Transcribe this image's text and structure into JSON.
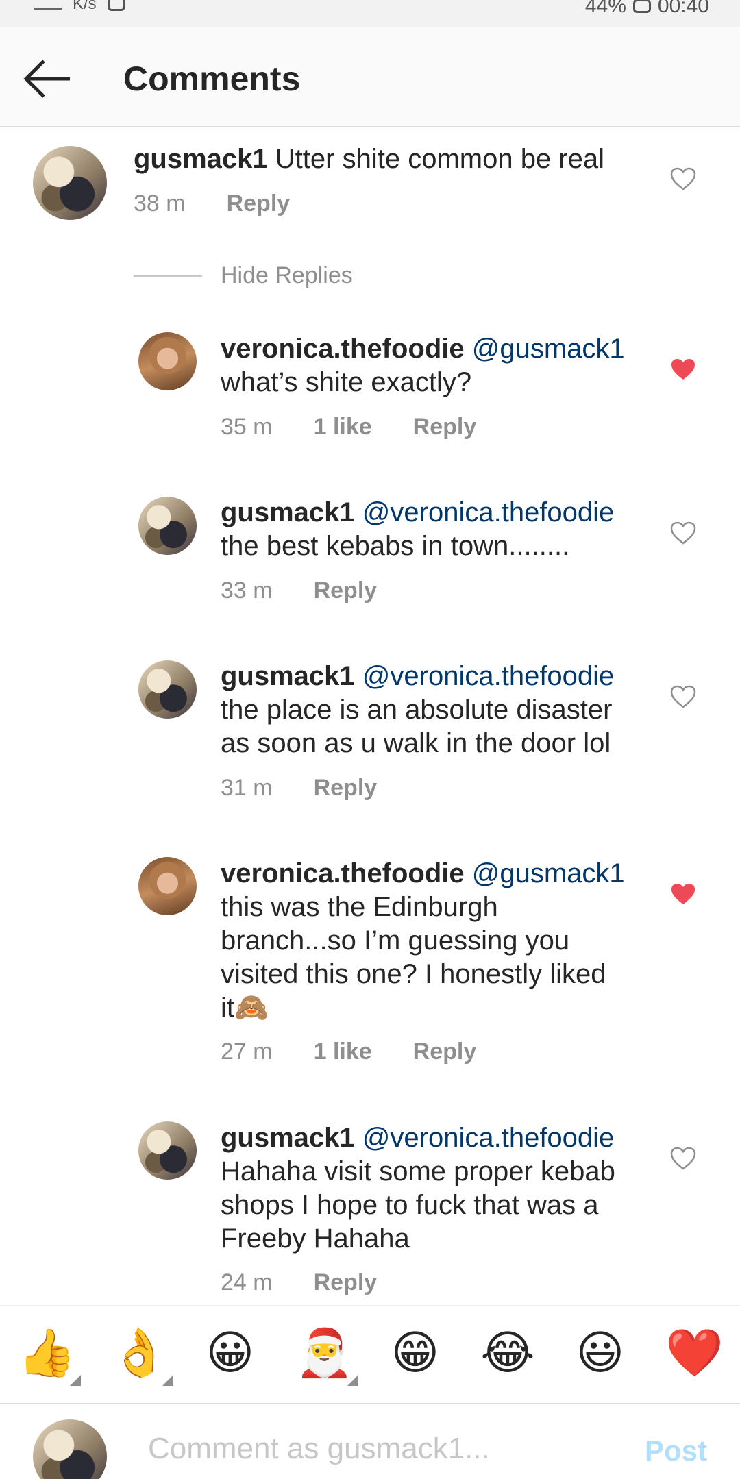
{
  "status_bar": {
    "left_text": "K/s",
    "battery": "44%",
    "time": "00:40"
  },
  "header": {
    "title": "Comments"
  },
  "top_comment": {
    "username": "gusmack1",
    "text": "Utter shite common be real",
    "time": "38 m",
    "reply_label": "Reply"
  },
  "hide_replies_label": "Hide Replies",
  "replies": [
    {
      "username": "veronica.thefoodie",
      "mention": "@gusmack1",
      "line1": "",
      "lines": [
        "what’s shite exactly?"
      ],
      "time": "35 m",
      "likes": "1 like",
      "reply_label": "Reply",
      "liked": true
    },
    {
      "username": "gusmack1",
      "mention": "@veronica.thefoodie",
      "lines": [
        "the best kebabs in town........"
      ],
      "time": "33 m",
      "likes": "",
      "reply_label": "Reply",
      "liked": false
    },
    {
      "username": "gusmack1",
      "mention": "@veronica.thefoodie",
      "lines": [
        "the place is an absolute disaster",
        "as soon as u walk in the door lol"
      ],
      "time": "31 m",
      "likes": "",
      "reply_label": "Reply",
      "liked": false
    },
    {
      "username": "veronica.thefoodie",
      "mention": "@gusmack1",
      "lines": [
        "this was the Edinburgh",
        "branch...so I’m guessing you",
        "visited this one? I honestly liked",
        "it🙈"
      ],
      "time": "27 m",
      "likes": "1 like",
      "reply_label": "Reply",
      "liked": true
    },
    {
      "username": "gusmack1",
      "mention": "@veronica.thefoodie",
      "lines": [
        "Hahaha visit some proper kebab",
        "shops I hope to fuck that was a",
        "Freeby Hahaha"
      ],
      "time": "24 m",
      "likes": "",
      "reply_label": "Reply",
      "liked": false
    }
  ],
  "emoji_bar": [
    "👍",
    "👌",
    "😀",
    "🎅",
    "😁",
    "😂",
    "😃",
    "❤️"
  ],
  "composer": {
    "placeholder": "Comment as gusmack1...",
    "post_label": "Post"
  },
  "colors": {
    "liked_heart": "#ed4956",
    "mention": "#00376b",
    "post_disabled": "#b2dffc"
  }
}
